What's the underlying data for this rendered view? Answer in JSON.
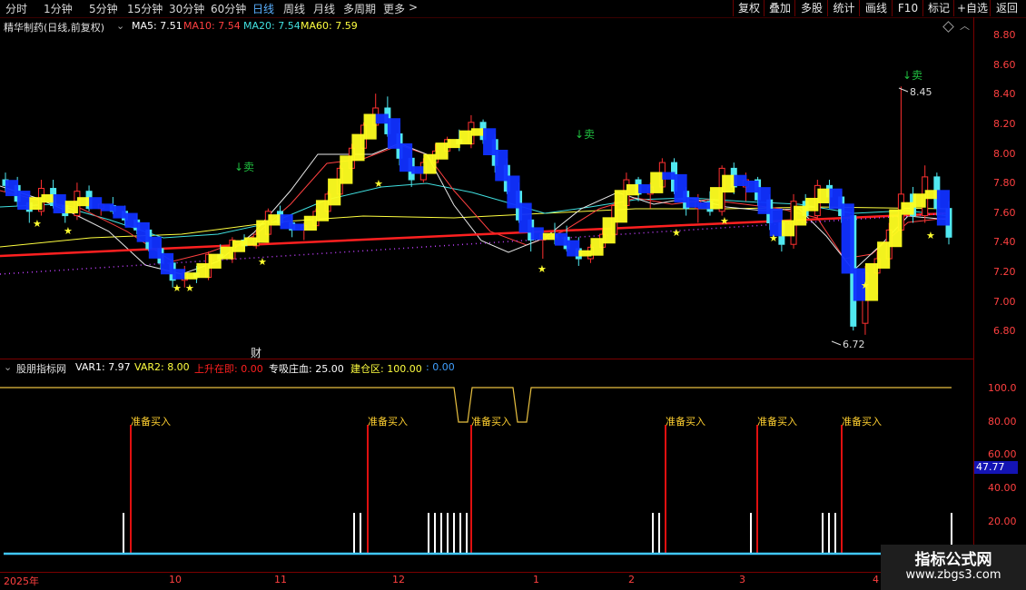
{
  "toolbar": {
    "periods": [
      "分时",
      "1分钟",
      "5分钟",
      "15分钟",
      "30分钟",
      "60分钟",
      "日线",
      "周线",
      "月线",
      "多周期",
      "更多"
    ],
    "active_period": "日线",
    "more_chevron": ">",
    "buttons": [
      "复权",
      "叠加",
      "多股",
      "统计",
      "画线",
      "F10",
      "标记",
      "+自选",
      "返回"
    ]
  },
  "stock": {
    "title": "精华制药(日线,前复权)",
    "ma": [
      {
        "label": "MA5: 7.51",
        "color": "#ffffff"
      },
      {
        "label": "MA10: 7.54",
        "color": "#ff4040"
      },
      {
        "label": "MA20: 7.54",
        "color": "#40e0e0"
      },
      {
        "label": "MA60: 7.59",
        "color": "#ffff40"
      }
    ]
  },
  "price_axis": [
    "8.80",
    "8.60",
    "8.40",
    "8.20",
    "8.00",
    "7.80",
    "7.60",
    "7.40",
    "7.20",
    "7.00",
    "6.80"
  ],
  "annotations": {
    "high": "8.45",
    "low": "6.72",
    "sell": "↓卖",
    "finance": "财"
  },
  "indicator": {
    "name": "股朋指标网",
    "values": [
      {
        "label": "VAR1: 7.97",
        "color": "#ffffff"
      },
      {
        "label": "VAR2: 8.00",
        "color": "#ffff40"
      },
      {
        "label": "上升在即: 0.00",
        "color": "#ff2020"
      },
      {
        "label": "专吸庄血: 25.00",
        "color": "#ffffff"
      },
      {
        "label": "建仓区: 100.00",
        "color": "#ffff40"
      },
      {
        "label": ": 0.00",
        "color": "#40a0ff"
      }
    ],
    "axis": [
      "100.0",
      "80.00",
      "60.00",
      "40.00",
      "20.00"
    ],
    "current": "47.77",
    "signal_label": "准备买入"
  },
  "time_axis": [
    "2025年",
    "10",
    "11",
    "12",
    "1",
    "2",
    "3",
    "4"
  ],
  "watermark": {
    "title": "指标公式网",
    "url": "www.zbgs3.com"
  },
  "chart_data": {
    "type": "candlestick",
    "ylim": [
      6.7,
      8.85
    ],
    "candles": [
      [
        7.8,
        7.85,
        7.72,
        7.76
      ],
      [
        7.76,
        7.82,
        7.62,
        7.65
      ],
      [
        7.64,
        7.7,
        7.5,
        7.58
      ],
      [
        7.58,
        7.8,
        7.55,
        7.74
      ],
      [
        7.74,
        7.8,
        7.6,
        7.62
      ],
      [
        7.62,
        7.66,
        7.5,
        7.55
      ],
      [
        7.55,
        7.78,
        7.52,
        7.72
      ],
      [
        7.72,
        7.76,
        7.58,
        7.6
      ],
      [
        7.6,
        7.65,
        7.55,
        7.63
      ],
      [
        7.62,
        7.68,
        7.56,
        7.58
      ],
      [
        7.58,
        7.62,
        7.48,
        7.52
      ],
      [
        7.52,
        7.56,
        7.42,
        7.45
      ],
      [
        7.45,
        7.5,
        7.3,
        7.32
      ],
      [
        7.32,
        7.38,
        7.18,
        7.22
      ],
      [
        7.22,
        7.25,
        7.05,
        7.1
      ],
      [
        7.1,
        7.2,
        7.05,
        7.15
      ],
      [
        7.15,
        7.2,
        7.08,
        7.12
      ],
      [
        7.12,
        7.3,
        7.1,
        7.28
      ],
      [
        7.28,
        7.35,
        7.22,
        7.25
      ],
      [
        7.25,
        7.4,
        7.22,
        7.38
      ],
      [
        7.38,
        7.42,
        7.3,
        7.34
      ],
      [
        7.34,
        7.45,
        7.32,
        7.42
      ],
      [
        7.42,
        7.6,
        7.4,
        7.58
      ],
      [
        7.58,
        7.62,
        7.48,
        7.5
      ],
      [
        7.5,
        7.55,
        7.4,
        7.45
      ],
      [
        7.45,
        7.5,
        7.38,
        7.48
      ],
      [
        7.48,
        7.6,
        7.46,
        7.58
      ],
      [
        7.58,
        7.72,
        7.55,
        7.7
      ],
      [
        7.7,
        7.9,
        7.68,
        7.88
      ],
      [
        7.88,
        8.05,
        7.85,
        8.02
      ],
      [
        8.02,
        8.2,
        8.0,
        8.18
      ],
      [
        8.18,
        8.4,
        8.15,
        8.3
      ],
      [
        8.3,
        8.38,
        8.1,
        8.12
      ],
      [
        8.12,
        8.2,
        7.9,
        7.95
      ],
      [
        7.95,
        8.0,
        7.75,
        7.8
      ],
      [
        7.8,
        7.95,
        7.78,
        7.92
      ],
      [
        7.92,
        8.05,
        7.88,
        8.0
      ],
      [
        8.0,
        8.1,
        7.95,
        8.08
      ],
      [
        8.08,
        8.15,
        8.0,
        8.05
      ],
      [
        8.05,
        8.25,
        8.02,
        8.2
      ],
      [
        8.2,
        8.22,
        8.05,
        8.08
      ],
      [
        8.08,
        8.12,
        7.85,
        7.9
      ],
      [
        7.9,
        7.95,
        7.7,
        7.72
      ],
      [
        7.72,
        7.78,
        7.5,
        7.52
      ],
      [
        7.52,
        7.55,
        7.3,
        7.38
      ],
      [
        7.38,
        7.45,
        7.25,
        7.42
      ],
      [
        7.42,
        7.5,
        7.35,
        7.4
      ],
      [
        7.4,
        7.48,
        7.3,
        7.32
      ],
      [
        7.32,
        7.4,
        7.2,
        7.25
      ],
      [
        7.25,
        7.35,
        7.22,
        7.33
      ],
      [
        7.33,
        7.45,
        7.3,
        7.42
      ],
      [
        7.42,
        7.65,
        7.4,
        7.62
      ],
      [
        7.62,
        7.85,
        7.6,
        7.8
      ],
      [
        7.8,
        7.82,
        7.65,
        7.7
      ],
      [
        7.7,
        7.78,
        7.6,
        7.75
      ],
      [
        7.75,
        7.95,
        7.72,
        7.92
      ],
      [
        7.92,
        7.95,
        7.7,
        7.72
      ],
      [
        7.72,
        7.75,
        7.55,
        7.6
      ],
      [
        7.6,
        7.7,
        7.5,
        7.65
      ],
      [
        7.65,
        7.72,
        7.55,
        7.58
      ],
      [
        7.58,
        7.9,
        7.55,
        7.88
      ],
      [
        7.88,
        7.92,
        7.7,
        7.75
      ],
      [
        7.75,
        7.85,
        7.65,
        7.8
      ],
      [
        7.8,
        7.82,
        7.62,
        7.66
      ],
      [
        7.66,
        7.7,
        7.45,
        7.5
      ],
      [
        7.5,
        7.58,
        7.3,
        7.35
      ],
      [
        7.35,
        7.7,
        7.32,
        7.65
      ],
      [
        7.65,
        7.7,
        7.5,
        7.55
      ],
      [
        7.55,
        7.8,
        7.52,
        7.76
      ],
      [
        7.76,
        7.8,
        7.6,
        7.68
      ],
      [
        7.68,
        7.72,
        7.5,
        7.55
      ],
      [
        7.55,
        7.6,
        6.75,
        6.78
      ],
      [
        6.8,
        7.2,
        6.72,
        7.15
      ],
      [
        7.15,
        7.3,
        7.0,
        7.25
      ],
      [
        7.25,
        7.5,
        7.2,
        7.45
      ],
      [
        7.45,
        8.45,
        7.4,
        7.7
      ],
      [
        7.7,
        7.75,
        7.5,
        7.55
      ],
      [
        7.55,
        7.9,
        7.5,
        7.82
      ],
      [
        7.82,
        7.85,
        7.55,
        7.6
      ],
      [
        7.6,
        7.65,
        7.35,
        7.4
      ]
    ]
  }
}
